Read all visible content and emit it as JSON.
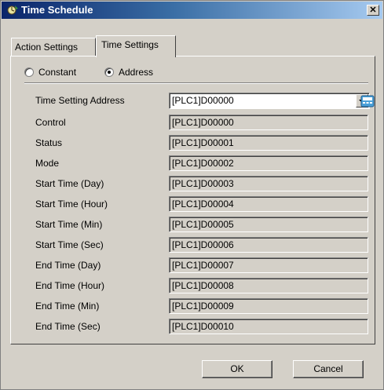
{
  "window": {
    "title": "Time Schedule",
    "close_symbol": "✕"
  },
  "tabs": [
    {
      "label": "Action Settings",
      "active": false
    },
    {
      "label": "Time Settings",
      "active": true
    }
  ],
  "mode": {
    "options": [
      {
        "label": "Constant",
        "selected": false
      },
      {
        "label": "Address",
        "selected": true
      }
    ]
  },
  "time_setting_address": {
    "label": "Time Setting Address",
    "value": "[PLC1]D00000"
  },
  "rows": [
    {
      "label": "Control",
      "value": "[PLC1]D00000"
    },
    {
      "label": "Status",
      "value": "[PLC1]D00001"
    },
    {
      "label": "Mode",
      "value": "[PLC1]D00002"
    },
    {
      "label": "Start Time (Day)",
      "value": "[PLC1]D00003"
    },
    {
      "label": "Start Time (Hour)",
      "value": "[PLC1]D00004"
    },
    {
      "label": "Start Time (Min)",
      "value": "[PLC1]D00005"
    },
    {
      "label": "Start Time (Sec)",
      "value": "[PLC1]D00006"
    },
    {
      "label": "End Time (Day)",
      "value": "[PLC1]D00007"
    },
    {
      "label": "End Time (Hour)",
      "value": "[PLC1]D00008"
    },
    {
      "label": "End Time (Min)",
      "value": "[PLC1]D00009"
    },
    {
      "label": "End Time (Sec)",
      "value": "[PLC1]D00010"
    }
  ],
  "buttons": {
    "ok": "OK",
    "cancel": "Cancel"
  },
  "icons": {
    "title_icon": "schedule-app-icon",
    "address_icon": "keypad-icon"
  }
}
